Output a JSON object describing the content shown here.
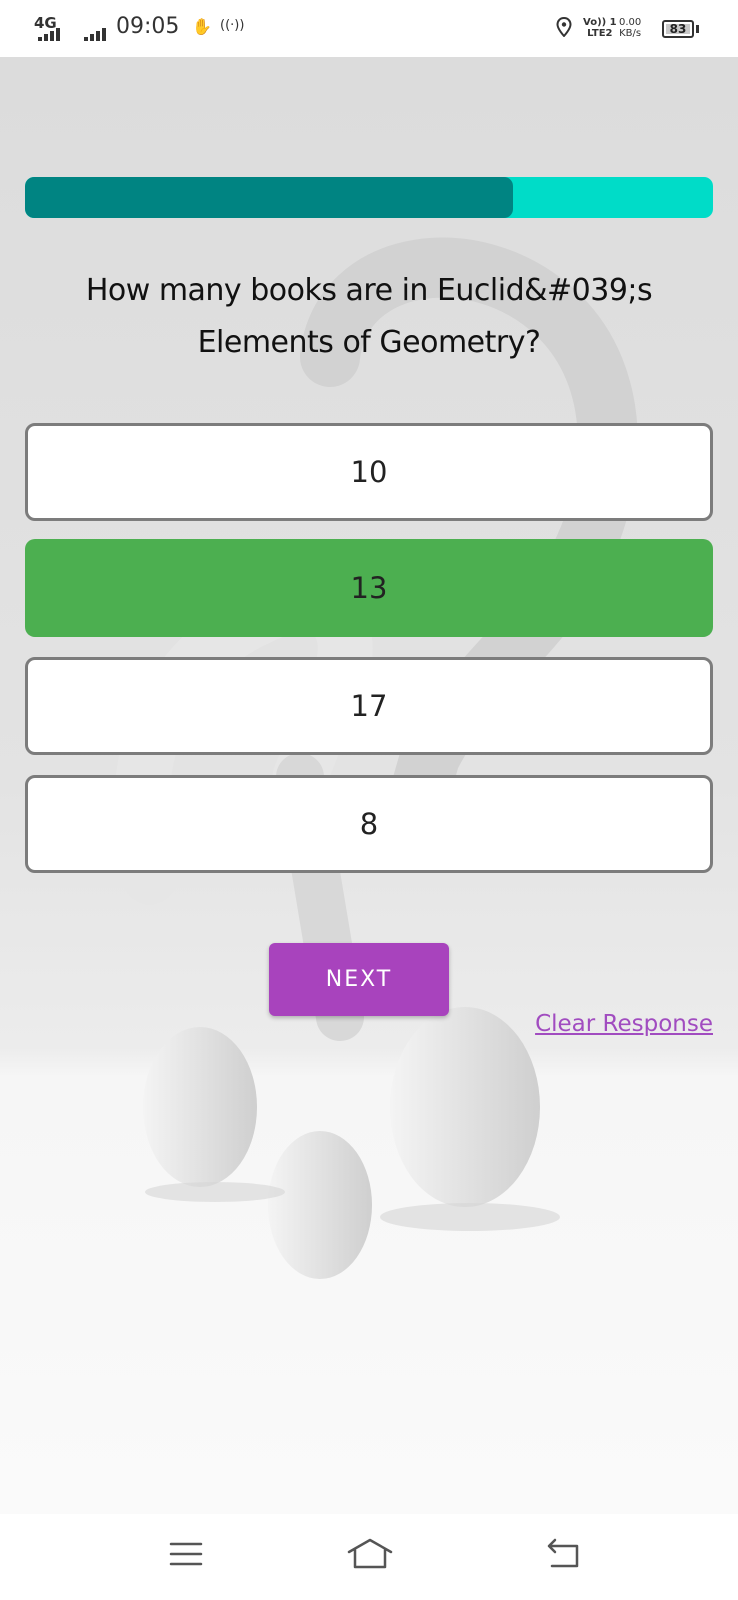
{
  "status_bar": {
    "network": "4G",
    "time": "09:05",
    "volte_top": "Vo)) 1",
    "volte_bottom": "LTE2",
    "speed_value": "0.00",
    "speed_unit": "KB/s",
    "battery": "83",
    "icons": [
      "signal-icon",
      "signal-icon",
      "hand-icon",
      "hotspot-icon",
      "location-icon",
      "battery-icon"
    ]
  },
  "quiz": {
    "progress": 0.71,
    "question": "How many books are in Euclid&#039;s Elements of Geometry?",
    "options": [
      {
        "label": "10",
        "state": "normal"
      },
      {
        "label": "13",
        "state": "correct"
      },
      {
        "label": "17",
        "state": "normal"
      },
      {
        "label": "8",
        "state": "normal"
      }
    ],
    "next_label": "NEXT",
    "clear_label": "Clear Response"
  },
  "colors": {
    "progress_track": "#00dcc8",
    "progress_fill": "#008482",
    "correct": "#4caf50",
    "next_button": "#a843bd",
    "clear_link": "#a14cc0"
  },
  "nav_bar": {
    "icons": [
      "menu-icon",
      "home-icon",
      "back-icon"
    ]
  }
}
